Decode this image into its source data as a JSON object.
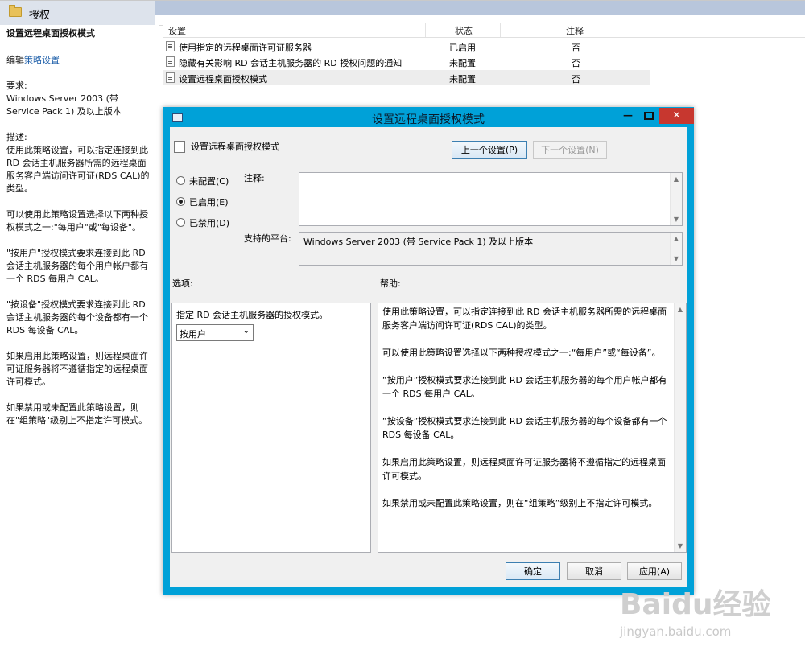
{
  "header": {
    "title": "授权"
  },
  "left_pane": {
    "title": "设置远程桌面授权模式",
    "edit_prefix": "编辑",
    "edit_link": "策略设置",
    "req_label": "要求:",
    "req_text": "Windows Server 2003 (带 Service Pack 1) 及以上版本",
    "desc_label": "描述:",
    "desc_1": "使用此策略设置，可以指定连接到此 RD 会话主机服务器所需的远程桌面服务客户端访问许可证(RDS CAL)的类型。",
    "desc_2": "可以使用此策略设置选择以下两种授权模式之一:\"每用户\"或\"每设备\"。",
    "desc_3": "\"按用户\"授权模式要求连接到此 RD 会话主机服务器的每个用户帐户都有一个 RDS 每用户 CAL。",
    "desc_4": "\"按设备\"授权模式要求连接到此 RD 会话主机服务器的每个设备都有一个 RDS 每设备 CAL。",
    "desc_5": "如果启用此策略设置，则远程桌面许可证服务器将不遵循指定的远程桌面许可模式。",
    "desc_6": "如果禁用或未配置此策略设置，则在\"组策略\"级别上不指定许可模式。"
  },
  "list": {
    "columns": [
      "设置",
      "状态",
      "注释"
    ],
    "rows": [
      {
        "name": "使用指定的远程桌面许可证服务器",
        "state": "已启用",
        "comment": "否"
      },
      {
        "name": "隐藏有关影响 RD 会话主机服务器的 RD 授权问题的通知",
        "state": "未配置",
        "comment": "否"
      },
      {
        "name": "设置远程桌面授权模式",
        "state": "未配置",
        "comment": "否"
      }
    ]
  },
  "dialog": {
    "title": "设置远程桌面授权模式",
    "setting_name": "设置远程桌面授权模式",
    "prev_button": "上一个设置(P)",
    "next_button": "下一个设置(N)",
    "radio_not_configured": "未配置(C)",
    "radio_enabled": "已启用(E)",
    "radio_disabled": "已禁用(D)",
    "selected_radio": "enabled",
    "comment_label": "注释:",
    "comment_value": "",
    "platform_label": "支持的平台:",
    "platform_value": "Windows Server 2003 (带 Service Pack 1) 及以上版本",
    "options_label": "选项:",
    "help_label": "帮助:",
    "option_caption": "指定 RD 会话主机服务器的授权模式。",
    "option_select": "按用户",
    "help_paragraphs": [
      "使用此策略设置，可以指定连接到此 RD 会话主机服务器所需的远程桌面服务客户端访问许可证(RDS CAL)的类型。",
      "可以使用此策略设置选择以下两种授权模式之一:“每用户”或“每设备”。",
      "“按用户”授权模式要求连接到此 RD 会话主机服务器的每个用户帐户都有一个 RDS 每用户 CAL。",
      "“按设备”授权模式要求连接到此 RD 会话主机服务器的每个设备都有一个 RDS 每设备 CAL。",
      "如果启用此策略设置，则远程桌面许可证服务器将不遵循指定的远程桌面许可模式。",
      "如果禁用或未配置此策略设置，则在“组策略”级别上不指定许可模式。"
    ],
    "ok_button": "确定",
    "cancel_button": "取消",
    "apply_button": "应用(A)"
  },
  "watermark": {
    "logo": "Baidu经验",
    "url": "jingyan.baidu.com"
  }
}
